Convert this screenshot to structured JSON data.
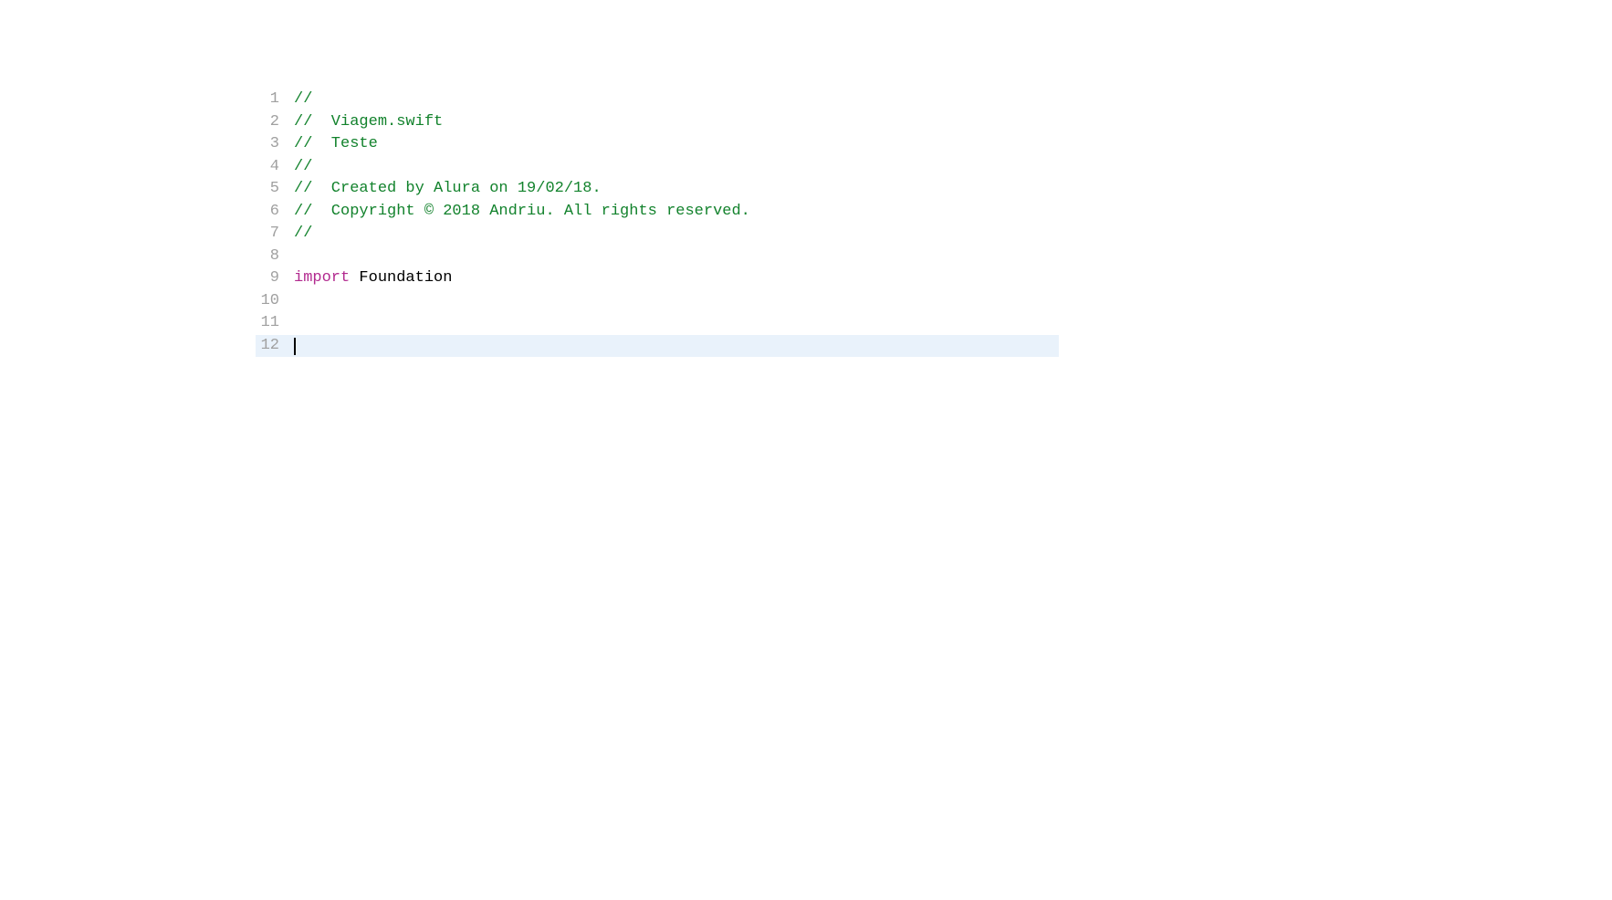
{
  "editor": {
    "lines": [
      {
        "number": "1",
        "type": "comment",
        "text": "//"
      },
      {
        "number": "2",
        "type": "comment",
        "text": "//  Viagem.swift"
      },
      {
        "number": "3",
        "type": "comment",
        "text": "//  Teste"
      },
      {
        "number": "4",
        "type": "comment",
        "text": "//"
      },
      {
        "number": "5",
        "type": "comment",
        "text": "//  Created by Alura on 19/02/18."
      },
      {
        "number": "6",
        "type": "comment",
        "text": "//  Copyright © 2018 Andriu. All rights reserved."
      },
      {
        "number": "7",
        "type": "comment",
        "text": "//"
      },
      {
        "number": "8",
        "type": "blank",
        "text": ""
      },
      {
        "number": "9",
        "type": "import",
        "keyword": "import",
        "identifier": "Foundation"
      },
      {
        "number": "10",
        "type": "blank",
        "text": ""
      },
      {
        "number": "11",
        "type": "blank",
        "text": ""
      },
      {
        "number": "12",
        "type": "cursor",
        "text": ""
      }
    ]
  }
}
